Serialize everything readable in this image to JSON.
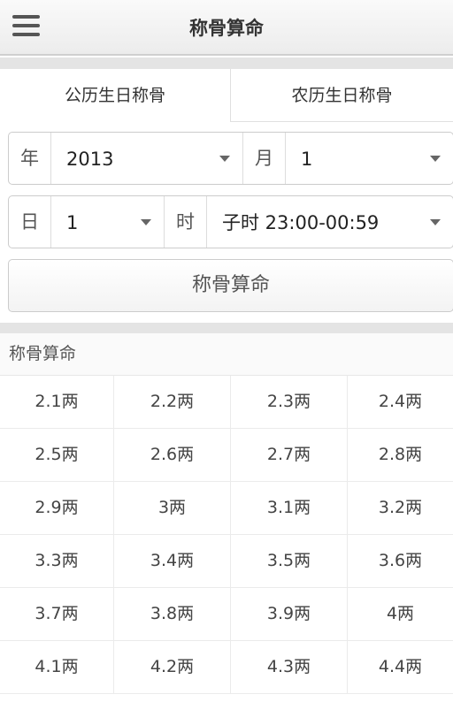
{
  "header": {
    "title": "称骨算命",
    "menu_icon": "hamburger-menu-icon"
  },
  "tabs": [
    {
      "label": "公历生日称骨",
      "active": true
    },
    {
      "label": "农历生日称骨",
      "active": false
    }
  ],
  "form": {
    "year_label": "年",
    "year_value": "2013",
    "month_label": "月",
    "month_value": "1",
    "day_label": "日",
    "day_value": "1",
    "hour_label": "时",
    "hour_value": "子时 23:00-00:59",
    "submit_label": "称骨算命"
  },
  "results": {
    "section_title": "称骨算命",
    "rows": [
      [
        "2.1两",
        "2.2两",
        "2.3两",
        "2.4两"
      ],
      [
        "2.5两",
        "2.6两",
        "2.7两",
        "2.8两"
      ],
      [
        "2.9两",
        "3两",
        "3.1两",
        "3.2两"
      ],
      [
        "3.3两",
        "3.4两",
        "3.5两",
        "3.6两"
      ],
      [
        "3.7两",
        "3.8两",
        "3.9两",
        "4两"
      ],
      [
        "4.1两",
        "4.2两",
        "4.3两",
        "4.4两"
      ]
    ]
  }
}
